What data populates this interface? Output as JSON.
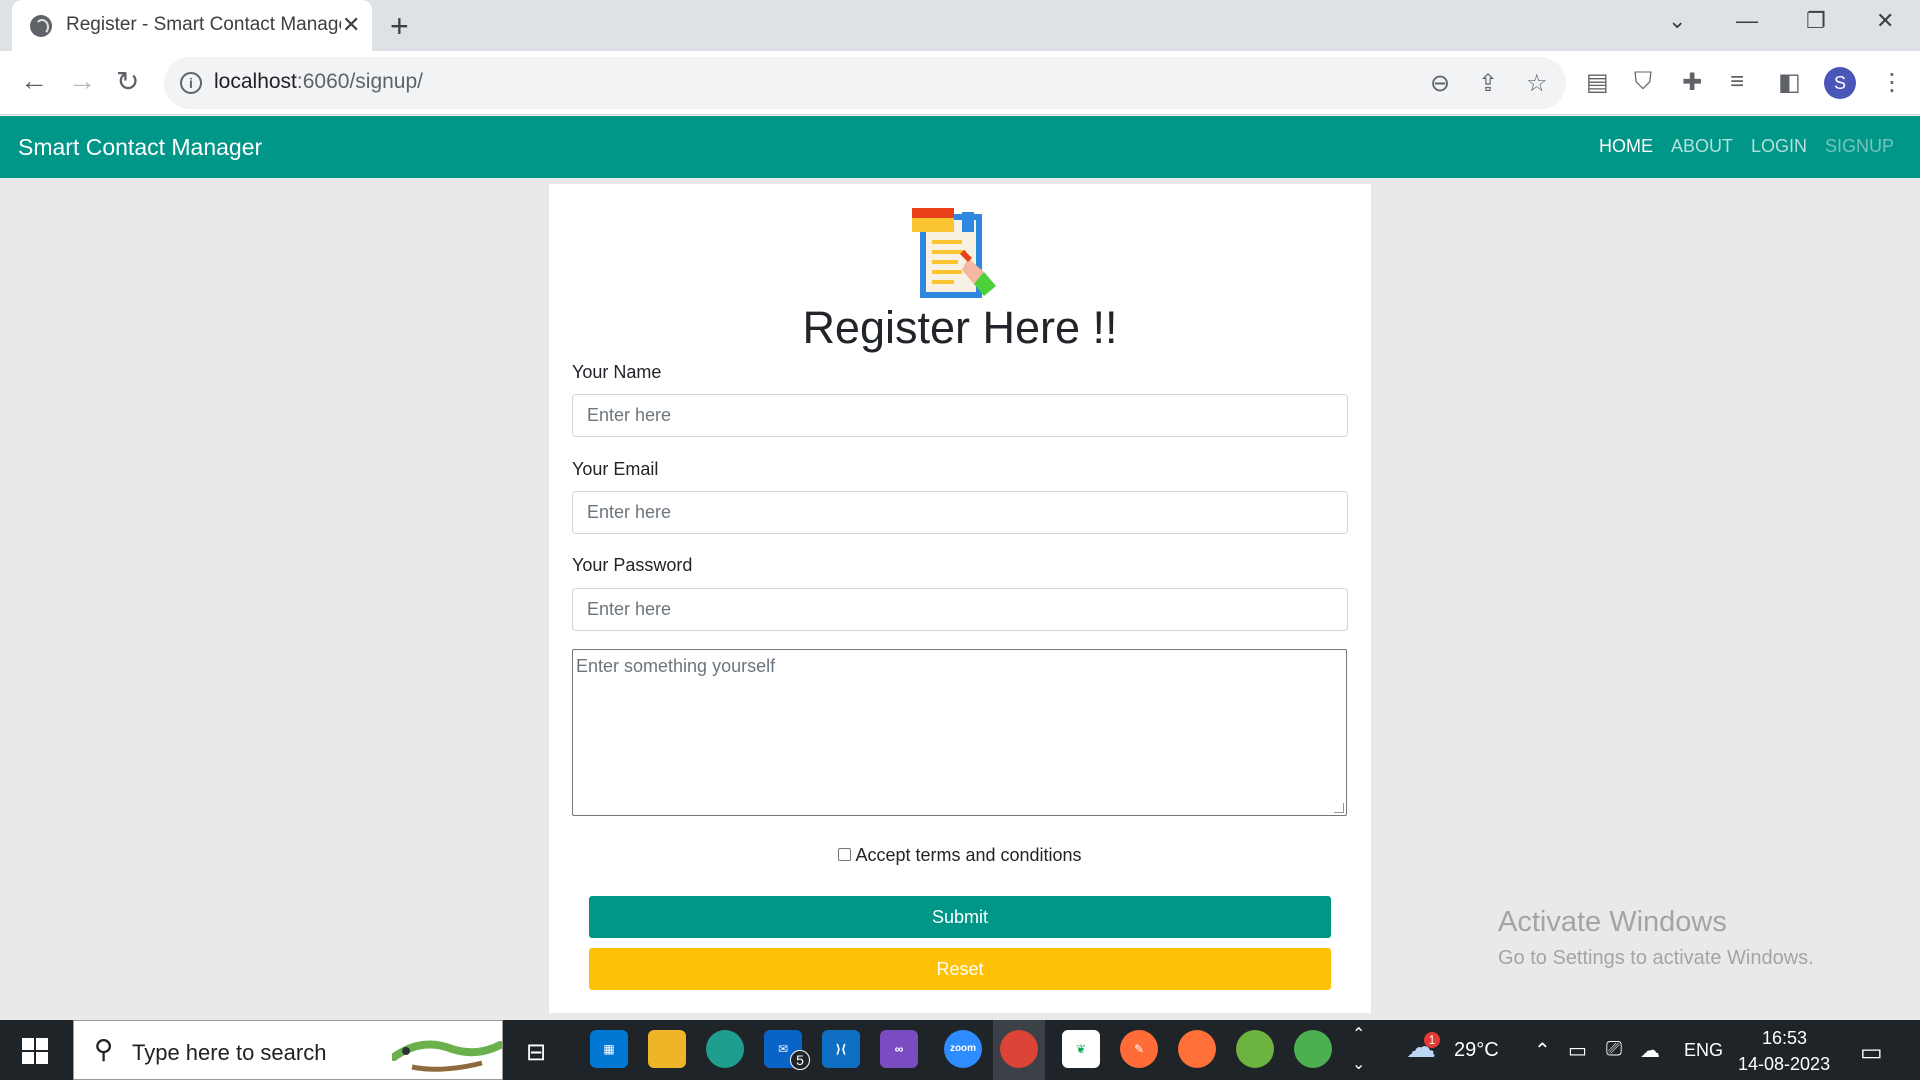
{
  "browser": {
    "tab_title": "Register - Smart Contact Manager",
    "tab_close": "✕",
    "new_tab": "+",
    "url_host": "localhost",
    "url_path": ":6060/signup/",
    "controls": {
      "dropdown": "⌄",
      "minimize": "—",
      "restore": "❐",
      "close": "✕"
    },
    "profile_initial": "S"
  },
  "navbar": {
    "brand": "Smart Contact Manager",
    "links": [
      {
        "label": "HOME",
        "state": "active"
      },
      {
        "label": "ABOUT",
        "state": "normal"
      },
      {
        "label": "LOGIN",
        "state": "normal"
      },
      {
        "label": "SIGNUP",
        "state": "disabled"
      }
    ],
    "color": "#009688"
  },
  "form": {
    "title": "Register Here !!",
    "name_label": "Your Name",
    "name_placeholder": "Enter here",
    "email_label": "Your Email",
    "email_placeholder": "Enter here",
    "password_label": "Your Password",
    "password_placeholder": "Enter here",
    "about_placeholder": "Enter something yourself",
    "terms_label": "Accept terms and conditions",
    "terms_checked": false,
    "submit_label": "Submit",
    "reset_label": "Reset",
    "submit_color": "#009688",
    "reset_color": "#ffc107"
  },
  "watermark": {
    "title": "Activate Windows",
    "subtitle": "Go to Settings to activate Windows."
  },
  "taskbar": {
    "search_placeholder": "Type here to search",
    "mail_badge": "5",
    "zoom_label": "zoom",
    "weather_badge": "1",
    "temperature": "29°C",
    "language": "ENG",
    "time": "16:53",
    "date": "14-08-2023"
  }
}
